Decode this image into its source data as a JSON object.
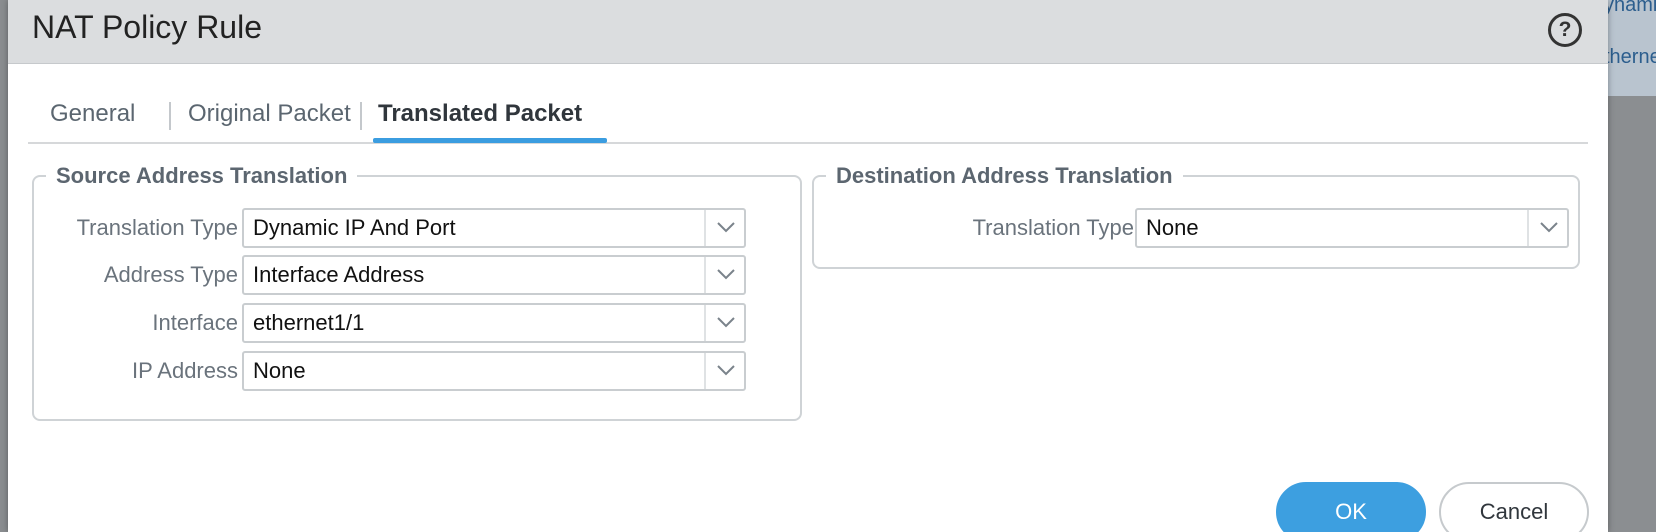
{
  "background": {
    "fragment_1": "ynami",
    "fragment_2": "therne"
  },
  "dialog": {
    "title": "NAT Policy Rule",
    "help_symbol": "?"
  },
  "tabs": [
    {
      "label": "General",
      "active": false
    },
    {
      "label": "Original Packet",
      "active": false
    },
    {
      "label": "Translated Packet",
      "active": true
    }
  ],
  "source_translation": {
    "legend": "Source Address Translation",
    "fields": [
      {
        "label": "Translation Type",
        "value": "Dynamic IP And Port"
      },
      {
        "label": "Address Type",
        "value": "Interface Address"
      },
      {
        "label": "Interface",
        "value": "ethernet1/1"
      },
      {
        "label": "IP Address",
        "value": "None"
      }
    ]
  },
  "destination_translation": {
    "legend": "Destination Address Translation",
    "fields": [
      {
        "label": "Translation Type",
        "value": "None"
      }
    ]
  },
  "buttons": {
    "ok": "OK",
    "cancel": "Cancel"
  },
  "colors": {
    "accent": "#3d9fe0",
    "titlebar": "#dbdddf"
  }
}
